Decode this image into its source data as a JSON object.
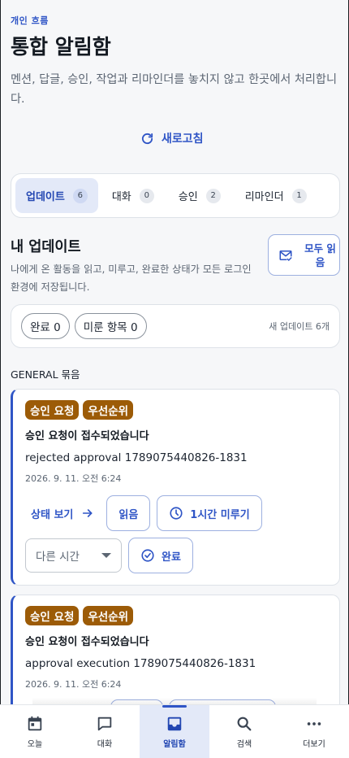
{
  "header": {
    "eyebrow": "개인 흐름",
    "title": "통합 알림함",
    "description": "멘션, 답글, 승인, 작업과 리마인더를 놓치지 않고 한곳에서 처리합니다.",
    "refresh_label": "새로고침"
  },
  "tabs": [
    {
      "label": "업데이트",
      "count": "6",
      "active": true
    },
    {
      "label": "대화",
      "count": "0",
      "active": false
    },
    {
      "label": "승인",
      "count": "2",
      "active": false
    },
    {
      "label": "리마인더",
      "count": "1",
      "active": false
    }
  ],
  "section": {
    "title": "내 업데이트",
    "description": "나에게 온 활동을 읽고, 미루고, 완료한 상태가 모든 로그인 환경에 저장됩니다.",
    "read_all_label": "모두 읽음"
  },
  "filters": {
    "done": "완료 0",
    "snoozed": "미룬 항목 0",
    "new_count": "새 업데이트 6개"
  },
  "group_label": "GENERAL 묶음",
  "cards": [
    {
      "badges": [
        "승인 요청",
        "우선순위"
      ],
      "title": "승인 요청이 접수되었습니다",
      "body": "rejected approval 1789075440826-1831",
      "time": "2026. 9. 11. 오전 6:24",
      "view_label": "상태 보기",
      "read_label": "읽음",
      "snooze_label": "1시간 미루기",
      "other_time_label": "다른 시간",
      "done_label": "완료"
    },
    {
      "badges": [
        "승인 요청",
        "우선순위"
      ],
      "title": "승인 요청이 접수되었습니다",
      "body": "approval execution 1789075440826-1831",
      "time": "2026. 9. 11. 오전 6:24"
    }
  ],
  "nav": [
    {
      "label": "오늘",
      "icon": "calendar-icon"
    },
    {
      "label": "대화",
      "icon": "chat-icon"
    },
    {
      "label": "알림함",
      "icon": "inbox-icon",
      "active": true
    },
    {
      "label": "검색",
      "icon": "search-icon"
    },
    {
      "label": "더보기",
      "icon": "more-icon"
    }
  ],
  "colors": {
    "accent": "#2f55c6",
    "badge": "#9c5b07",
    "active_bg": "#e3e9f8"
  }
}
